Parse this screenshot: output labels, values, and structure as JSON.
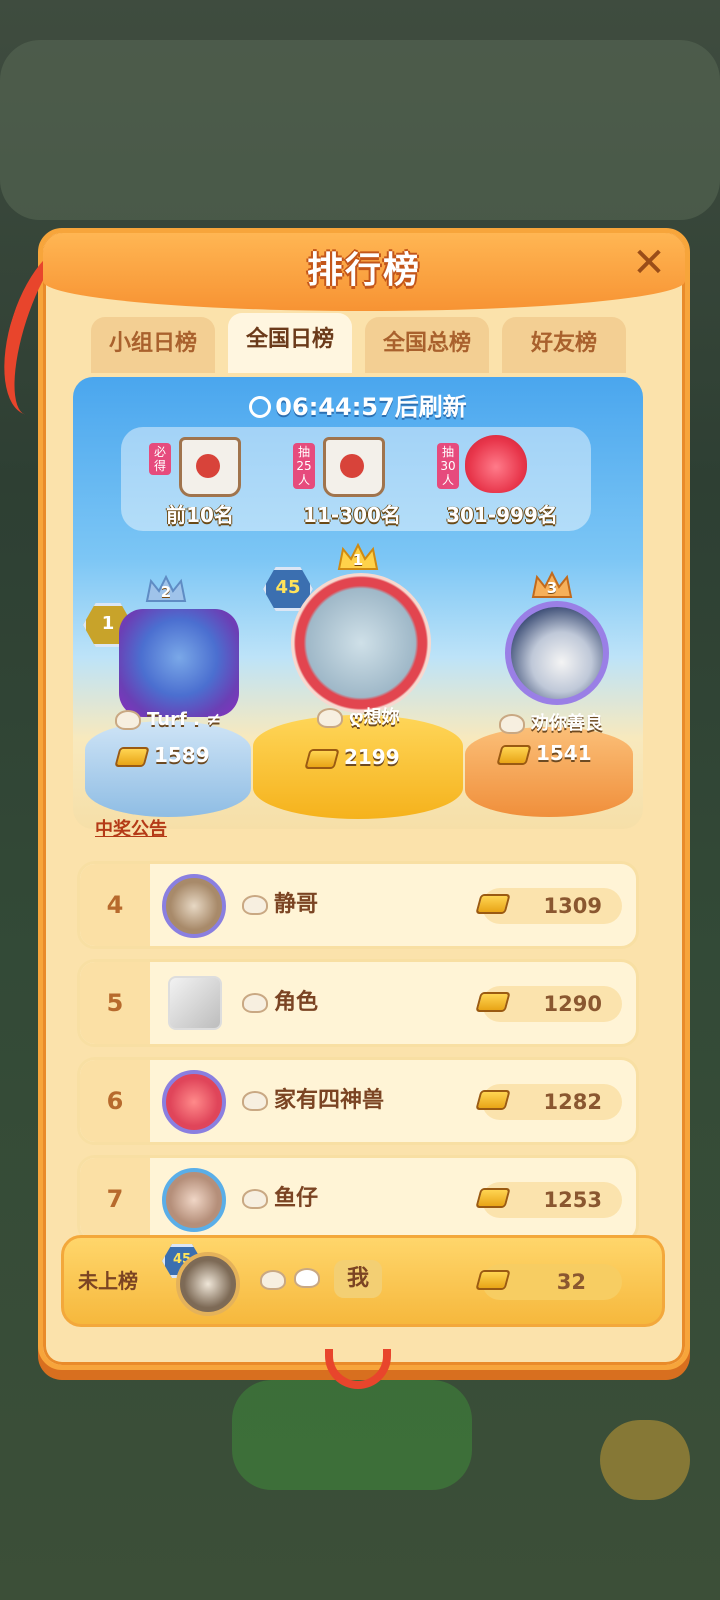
{
  "modal": {
    "title": "排行榜",
    "close_label": "✕"
  },
  "tabs": [
    {
      "label": "小组日榜",
      "active": false
    },
    {
      "label": "全国日榜",
      "active": true
    },
    {
      "label": "全国总榜",
      "active": false
    },
    {
      "label": "好友榜",
      "active": false
    }
  ],
  "timer": {
    "countdown": "06:44:57",
    "suffix": "后刷新"
  },
  "rewards": [
    {
      "tag": "必得",
      "label": "前10名"
    },
    {
      "tag": "抽25人",
      "label": "11-300名"
    },
    {
      "tag": "抽30人",
      "label": "301-999名"
    }
  ],
  "podium": {
    "first": {
      "rank": "1",
      "level": "45",
      "name": "ღ想妳",
      "score": "2199"
    },
    "second": {
      "rank": "2",
      "level": "1",
      "name": "Turf . ≠",
      "score": "1589"
    },
    "third": {
      "rank": "3",
      "name": "劝你善良",
      "score": "1541"
    }
  },
  "announcement": "中奖公告",
  "list": [
    {
      "rank": "4",
      "name": "静哥",
      "score": "1309"
    },
    {
      "rank": "5",
      "name": "角色",
      "score": "1290"
    },
    {
      "rank": "6",
      "name": "家有四神兽",
      "score": "1282"
    },
    {
      "rank": "7",
      "name": "鱼仔",
      "score": "1253"
    }
  ],
  "me": {
    "rank_label": "未上榜",
    "level": "45",
    "name": "我",
    "score": "32"
  },
  "colors": {
    "accent": "#f79333",
    "panel": "#fbe2ab",
    "text_brown": "#7b4423"
  }
}
